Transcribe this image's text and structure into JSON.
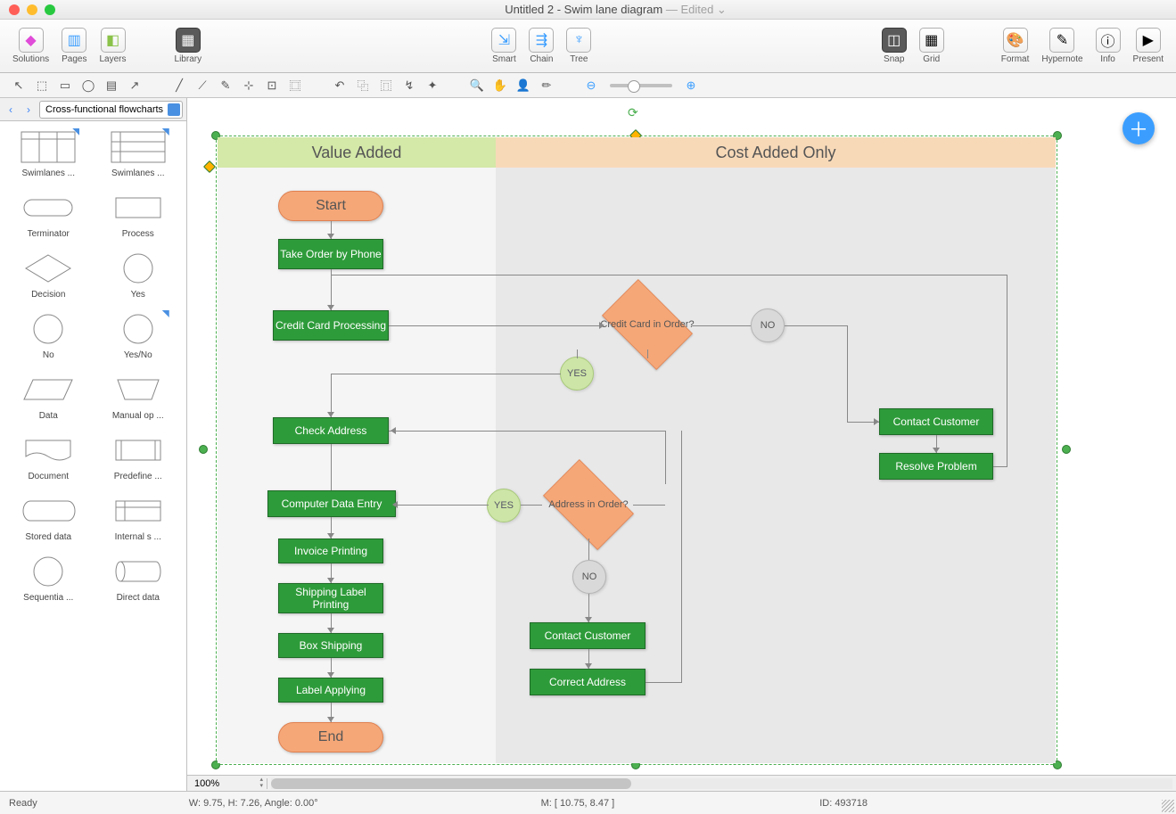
{
  "title": {
    "main": "Untitled 2 - Swim lane diagram",
    "suffix": " — Edited ⌄"
  },
  "toolbar": {
    "left": [
      {
        "name": "solutions",
        "icon": "◆",
        "label": "Solutions",
        "color": "#e04bd8"
      },
      {
        "name": "pages",
        "icon": "▥",
        "label": "Pages",
        "color": "#3b9eff"
      },
      {
        "name": "layers",
        "icon": "◧",
        "label": "Layers",
        "color": "#8bc34a"
      }
    ],
    "library": {
      "icon": "▦",
      "label": "Library"
    },
    "center": [
      {
        "name": "smart",
        "icon": "⇲",
        "label": "Smart"
      },
      {
        "name": "chain",
        "icon": "⇶",
        "label": "Chain"
      },
      {
        "name": "tree",
        "icon": "♆",
        "label": "Tree"
      }
    ],
    "rightA": [
      {
        "name": "snap",
        "icon": "◫",
        "label": "Snap",
        "dark": true
      },
      {
        "name": "grid",
        "icon": "▦",
        "label": "Grid"
      }
    ],
    "rightB": [
      {
        "name": "format",
        "icon": "🎨",
        "label": "Format"
      },
      {
        "name": "hypernote",
        "icon": "✎",
        "label": "Hypernote"
      },
      {
        "name": "info",
        "icon": "ⓘ",
        "label": "Info"
      },
      {
        "name": "present",
        "icon": "▶",
        "label": "Present"
      }
    ]
  },
  "tools": [
    "↖",
    "⬚",
    "▭",
    "◯",
    "▤",
    "↗",
    "╱",
    "⟋",
    "✎",
    "⊹",
    "⊡",
    "⿴",
    "↶",
    "⿻",
    "⿵",
    "↯",
    "✦",
    "🔍",
    "✋",
    "👤",
    "✏",
    "⊖",
    "⊕"
  ],
  "library": {
    "selector": "Cross-functional flowcharts",
    "items": [
      {
        "name": "swimlanes-v",
        "label": "Swimlanes  ...",
        "svg": "swimv"
      },
      {
        "name": "swimlanes-h",
        "label": "Swimlanes  ...",
        "svg": "swimh"
      },
      {
        "name": "terminator",
        "label": "Terminator",
        "svg": "term"
      },
      {
        "name": "process",
        "label": "Process",
        "svg": "rect"
      },
      {
        "name": "decision",
        "label": "Decision",
        "svg": "diamond"
      },
      {
        "name": "yes",
        "label": "Yes",
        "svg": "circle"
      },
      {
        "name": "no",
        "label": "No",
        "svg": "circle"
      },
      {
        "name": "yesno",
        "label": "Yes/No",
        "svg": "circle"
      },
      {
        "name": "data",
        "label": "Data",
        "svg": "para"
      },
      {
        "name": "manual-op",
        "label": "Manual op ...",
        "svg": "trap"
      },
      {
        "name": "document",
        "label": "Document",
        "svg": "doc"
      },
      {
        "name": "predefine",
        "label": "Predefine ...",
        "svg": "predef"
      },
      {
        "name": "stored-data",
        "label": "Stored data",
        "svg": "stored"
      },
      {
        "name": "internal-s",
        "label": "Internal s ...",
        "svg": "intern"
      },
      {
        "name": "sequentia",
        "label": "Sequentia ...",
        "svg": "circle"
      },
      {
        "name": "direct-data",
        "label": "Direct data",
        "svg": "cyl"
      }
    ]
  },
  "diagram": {
    "lane1_title": "Value Added",
    "lane2_title": "Cost Added Only",
    "start": "Start",
    "take_order": "Take Order by Phone",
    "cc_proc": "Credit Card Processing",
    "cc_order": "Credit Card in Order?",
    "check_addr": "Check Address",
    "addr_order": "Address in Order?",
    "cde": "Computer Data Entry",
    "inv_print": "Invoice Printing",
    "ship_label": "Shipping Label Printing",
    "box_ship": "Box Shipping",
    "label_apply": "Label Applying",
    "end": "End",
    "contact_cust": "Contact Customer",
    "resolve": "Resolve Problem",
    "contact_cust2": "Contact Customer",
    "correct_addr": "Correct Address",
    "yes": "YES",
    "no": "NO"
  },
  "zoom": "100%",
  "status": {
    "ready": "Ready",
    "wh": "W: 9.75,  H: 7.26,  Angle: 0.00°",
    "mouse": "M: [ 10.75, 8.47 ]",
    "id": "ID: 493718"
  }
}
